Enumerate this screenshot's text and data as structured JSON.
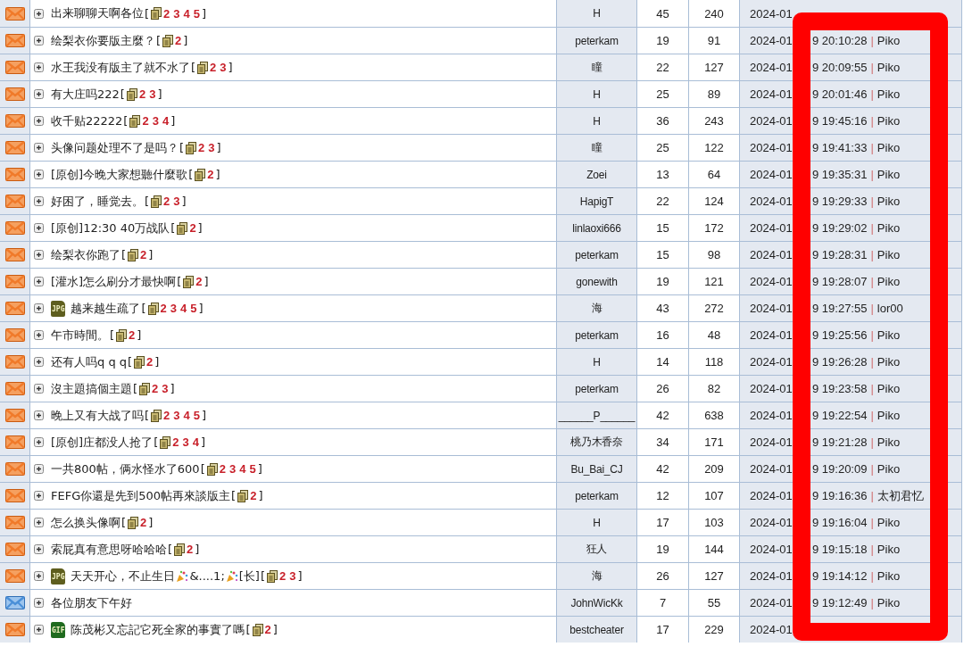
{
  "threads": [
    {
      "new": true,
      "title": "出来聊聊天啊各位",
      "pages_open": "[",
      "pages": [
        "2",
        "3",
        "4",
        "5"
      ],
      "pages_close": "]",
      "author": "H",
      "replies": "45",
      "views": "240",
      "date_start": "2024-01"
    },
    {
      "new": true,
      "title": "绘梨衣你要版主麼？",
      "pages_open": "[",
      "pages": [
        "2"
      ],
      "pages_close": "]",
      "author": "peterkam",
      "replies": "19",
      "views": "91",
      "date_start": "2024-01",
      "date_end": "9 20:10:28",
      "sep": "|",
      "last_poster": "Piko"
    },
    {
      "new": true,
      "title": "水王我没有版主了就不水了",
      "pages_open": "[",
      "pages": [
        "2",
        "3"
      ],
      "pages_close": "]",
      "author": "瞳",
      "replies": "22",
      "views": "127",
      "date_start": "2024-01",
      "date_end": "9 20:09:55",
      "sep": "|",
      "last_poster": "Piko"
    },
    {
      "new": true,
      "title": "有大庄吗222",
      "pages_open": "[",
      "pages": [
        "2",
        "3"
      ],
      "pages_close": "]",
      "author": "H",
      "replies": "25",
      "views": "89",
      "date_start": "2024-01",
      "date_end": "9 20:01:46",
      "sep": "|",
      "last_poster": "Piko"
    },
    {
      "new": true,
      "title": "收千贴22222",
      "pages_open": "[",
      "pages": [
        "2",
        "3",
        "4"
      ],
      "pages_close": "]",
      "author": "H",
      "replies": "36",
      "views": "243",
      "date_start": "2024-01",
      "date_end": "9 19:45:16",
      "sep": "|",
      "last_poster": "Piko"
    },
    {
      "new": true,
      "title": "头像问题处理不了是吗？",
      "pages_open": "[",
      "pages": [
        "2",
        "3"
      ],
      "pages_close": "]",
      "author": "瞳",
      "replies": "25",
      "views": "122",
      "date_start": "2024-01",
      "date_end": "9 19:41:33",
      "sep": "|",
      "last_poster": "Piko"
    },
    {
      "new": true,
      "title": "[原创]今晚大家想聽什麼歌",
      "pages_open": "[",
      "pages": [
        "2"
      ],
      "pages_close": "]",
      "author": "Zoei",
      "replies": "13",
      "views": "64",
      "date_start": "2024-01",
      "date_end": "9 19:35:31",
      "sep": "|",
      "last_poster": "Piko"
    },
    {
      "new": true,
      "title": "好困了，睡觉去。",
      "pages_open": "[",
      "pages": [
        "2",
        "3"
      ],
      "pages_close": "]",
      "author": "HapigT",
      "replies": "22",
      "views": "124",
      "date_start": "2024-01",
      "date_end": "9 19:29:33",
      "sep": "|",
      "last_poster": "Piko"
    },
    {
      "new": true,
      "title": "[原创]12:30 40万战队",
      "pages_open": "[",
      "pages": [
        "2"
      ],
      "pages_close": "]",
      "author": "linlaoxi666",
      "replies": "15",
      "views": "172",
      "date_start": "2024-01",
      "date_end": "9 19:29:02",
      "sep": "|",
      "last_poster": "Piko"
    },
    {
      "new": true,
      "title": "绘梨衣你跑了",
      "pages_open": "[",
      "pages": [
        "2"
      ],
      "pages_close": "]",
      "author": "peterkam",
      "replies": "15",
      "views": "98",
      "date_start": "2024-01",
      "date_end": "9 19:28:31",
      "sep": "|",
      "last_poster": "Piko"
    },
    {
      "new": true,
      "title": "[灌水]怎么刷分才最快啊",
      "pages_open": "[",
      "pages": [
        "2"
      ],
      "pages_close": "]",
      "author": "gonewith",
      "replies": "19",
      "views": "121",
      "date_start": "2024-01",
      "date_end": "9 19:28:07",
      "sep": "|",
      "last_poster": "Piko"
    },
    {
      "new": true,
      "attachment": {
        "kind": "jpg",
        "label": "JPG"
      },
      "title": "越来越生疏了",
      "pages_open": "[",
      "pages": [
        "2",
        "3",
        "4",
        "5"
      ],
      "pages_close": "]",
      "author": "海",
      "replies": "43",
      "views": "272",
      "date_start": "2024-01",
      "date_end": "9 19:27:55",
      "sep": "|",
      "last_poster": "lor00"
    },
    {
      "new": true,
      "title": "午市時間。",
      "pages_open": "[",
      "pages": [
        "2"
      ],
      "pages_close": "]",
      "author": "peterkam",
      "replies": "16",
      "views": "48",
      "date_start": "2024-01",
      "date_end": "9 19:25:56",
      "sep": "|",
      "last_poster": "Piko"
    },
    {
      "new": true,
      "title": "还有人吗q q q",
      "pages_open": "[",
      "pages": [
        "2"
      ],
      "pages_close": "]",
      "author": "H",
      "replies": "14",
      "views": "118",
      "date_start": "2024-01",
      "date_end": "9 19:26:28",
      "sep": "|",
      "last_poster": "Piko"
    },
    {
      "new": true,
      "title": "沒主題搞個主題",
      "pages_open": "[",
      "pages": [
        "2",
        "3"
      ],
      "pages_close": "]",
      "author": "peterkam",
      "replies": "26",
      "views": "82",
      "date_start": "2024-01",
      "date_end": "9 19:23:58",
      "sep": "|",
      "last_poster": "Piko"
    },
    {
      "new": true,
      "title": "晚上又有大战了吗",
      "pages_open": "[",
      "pages": [
        "2",
        "3",
        "4",
        "5"
      ],
      "pages_close": "]",
      "author": "______P______",
      "replies": "42",
      "views": "638",
      "date_start": "2024-01",
      "date_end": "9 19:22:54",
      "sep": "|",
      "last_poster": "Piko"
    },
    {
      "new": true,
      "title": "[原创]庄都没人抢了",
      "pages_open": "[",
      "pages": [
        "2",
        "3",
        "4"
      ],
      "pages_close": "]",
      "author": "桃乃木香奈",
      "replies": "34",
      "views": "171",
      "date_start": "2024-01",
      "date_end": "9 19:21:28",
      "sep": "|",
      "last_poster": "Piko"
    },
    {
      "new": true,
      "title": "一共800帖，俩水怪水了600",
      "pages_open": "[",
      "pages": [
        "2",
        "3",
        "4",
        "5"
      ],
      "pages_close": "]",
      "author": "Bu_Bai_CJ",
      "replies": "42",
      "views": "209",
      "date_start": "2024-01",
      "date_end": "9 19:20:09",
      "sep": "|",
      "last_poster": "Piko"
    },
    {
      "new": true,
      "title": "FEFG你還是先到500帖再來談版主",
      "pages_open": "[",
      "pages": [
        "2"
      ],
      "pages_close": "]",
      "author": "peterkam",
      "replies": "12",
      "views": "107",
      "date_start": "2024-01",
      "date_end": "9 19:16:36",
      "sep": "|",
      "last_poster": "太初君忆"
    },
    {
      "new": true,
      "title": "怎么换头像啊",
      "pages_open": "[",
      "pages": [
        "2"
      ],
      "pages_close": "]",
      "author": "H",
      "replies": "17",
      "views": "103",
      "date_start": "2024-01",
      "date_end": "9 19:16:04",
      "sep": "|",
      "last_poster": "Piko"
    },
    {
      "new": true,
      "title": "索屁真有意思呀哈哈哈",
      "pages_open": "[",
      "pages": [
        "2"
      ],
      "pages_close": "]",
      "author": "狂人",
      "replies": "19",
      "views": "144",
      "date_start": "2024-01",
      "date_end": "9 19:15:18",
      "sep": "|",
      "last_poster": "Piko"
    },
    {
      "new": true,
      "attachment": {
        "kind": "jpg",
        "label": "JPG"
      },
      "title_parts": [
        {
          "kind": "text",
          "text": "天天开心，不止生日"
        },
        {
          "kind": "emoji"
        },
        {
          "kind": "text",
          "text": "&....1;"
        },
        {
          "kind": "emoji"
        },
        {
          "kind": "text",
          "text": "[长]"
        }
      ],
      "pages_open": "[",
      "pages": [
        "2",
        "3"
      ],
      "pages_close": "]",
      "author": "海",
      "replies": "26",
      "views": "127",
      "date_start": "2024-01",
      "date_end": "9 19:14:12",
      "sep": "|",
      "last_poster": "Piko"
    },
    {
      "new": false,
      "title": "各位朋友下午好",
      "author": "JohnWicKk",
      "replies": "7",
      "views": "55",
      "date_start": "2024-01",
      "date_end": "9 19:12:49",
      "sep": "|",
      "last_poster": "Piko"
    },
    {
      "new": true,
      "attachment": {
        "kind": "gif",
        "label": "GIF"
      },
      "title": "陈茂彬又忘記它死全家的事實了嗎",
      "pages_open": "[",
      "pages": [
        "2"
      ],
      "pages_close": "]",
      "author": "bestcheater",
      "replies": "17",
      "views": "229",
      "date_start": "2024-01"
    }
  ]
}
